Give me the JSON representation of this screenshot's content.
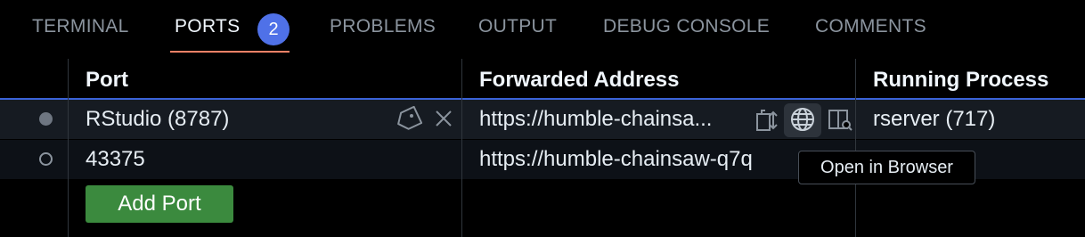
{
  "tabs": [
    {
      "label": "TERMINAL"
    },
    {
      "label": "PORTS",
      "active": true,
      "badge": "2"
    },
    {
      "label": "PROBLEMS"
    },
    {
      "label": "OUTPUT"
    },
    {
      "label": "DEBUG CONSOLE"
    },
    {
      "label": "COMMENTS"
    }
  ],
  "table": {
    "columns": [
      "Port",
      "Forwarded Address",
      "Running Process"
    ],
    "rows": [
      {
        "port": "RStudio (8787)",
        "address": "https://humble-chainsa...",
        "process": "rserver (717)",
        "status": "running"
      },
      {
        "port": "43375",
        "address": "https://humble-chainsaw-q7q",
        "process": "",
        "status": "idle"
      }
    ]
  },
  "actions": {
    "add_port_label": "Add Port"
  },
  "tooltip": {
    "text": "Open in Browser"
  },
  "icons": {
    "label": "tag-icon",
    "stop": "close-icon",
    "copy": "copy-address-icon",
    "browser": "globe-icon",
    "preview": "preview-icon"
  },
  "colors": {
    "accent_tab": "#f78166",
    "badge": "#4f71e8",
    "add_button": "#3b8a3e",
    "focus": "#3b63d8"
  }
}
